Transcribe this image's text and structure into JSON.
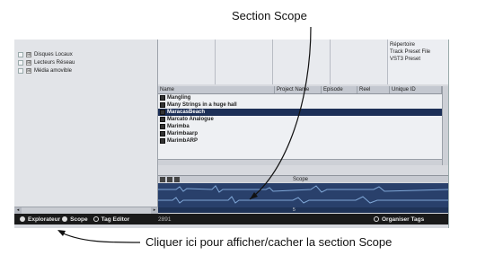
{
  "callouts": {
    "top": "Section Scope",
    "bottom": "Cliquer ici pour afficher/cacher la section Scope"
  },
  "tree": {
    "items": [
      {
        "label": "Disques Locaux",
        "expander": "⊞"
      },
      {
        "label": "Lecteurs Réseau",
        "expander": "⊞"
      },
      {
        "label": "Média amovible",
        "expander": "⊞"
      }
    ]
  },
  "attributes": {
    "items": [
      "Répertoire",
      "Track Preset File",
      "VST3 Preset"
    ]
  },
  "list": {
    "columns": [
      "Name",
      "Project Name",
      "Episode",
      "Reel",
      "Unique ID"
    ],
    "rows": [
      "Mangling",
      "Many Strings in a huge hall",
      "MaracasBeach",
      "Marcato Analogue",
      "Marimba",
      "Marimbaarp",
      "MarimbARP"
    ],
    "selected_index": 2
  },
  "scope": {
    "label": "Scope",
    "ruler_mark": "5"
  },
  "status": {
    "explorer_label": "Explorateur",
    "scope_label": "Scope",
    "tag_editor_label": "Tag Editor",
    "counter": "2891",
    "organiser_label": "Organiser Tags"
  },
  "colors": {
    "selection": "#1c2f57",
    "scope_bg": "#29406b",
    "waveform": "#7fa6d6",
    "statusbar": "#1a1a1a"
  }
}
